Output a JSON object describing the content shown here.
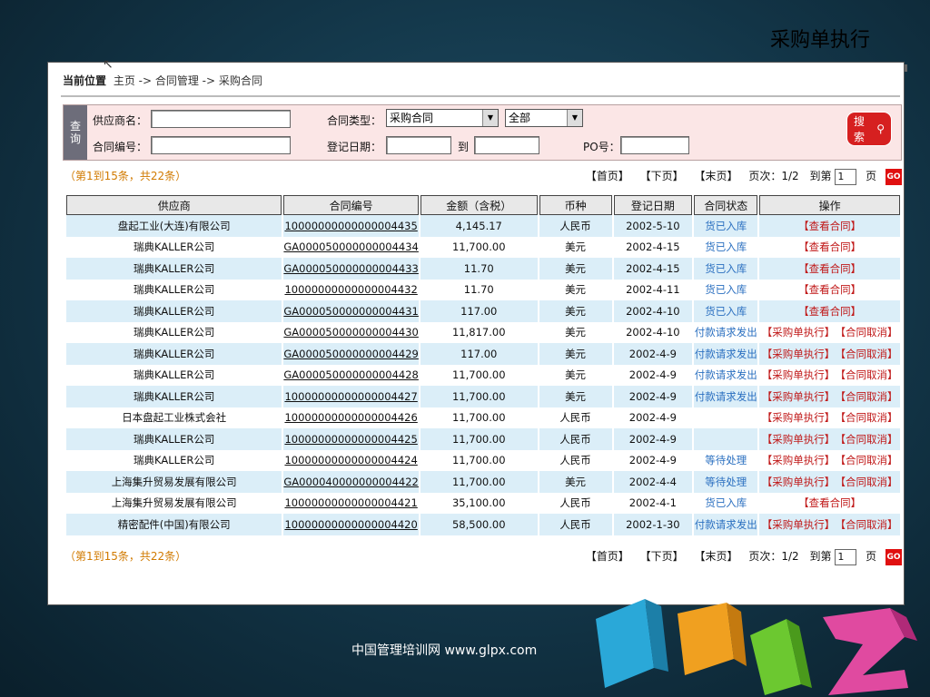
{
  "slide_title": "采购单执行",
  "footer": "中国管理培训网   www.glpx.com",
  "breadcrumb": {
    "lead": "当前位置",
    "path": "主页 -> 合同管理 -> 采购合同"
  },
  "search": {
    "tag": "查询",
    "supplier_label": "供应商名：",
    "contract_no_label": "合同编号：",
    "contract_type_label": "合同类型：",
    "contract_type_value": "采购合同",
    "scope_value": "全部",
    "reg_date_label": "登记日期：",
    "to_label": "到",
    "po_label": "PO号：",
    "button": "搜索"
  },
  "pager": {
    "count": "（第1到15条，共22条）",
    "first": "【首页】",
    "next": "【下页】",
    "last": "【末页】",
    "page_info": "页次：1/2",
    "goto_label": "到第",
    "page_value": "1",
    "page_unit": "页",
    "go": "GO"
  },
  "table": {
    "headers": [
      "供应商",
      "合同编号",
      "金额（含税）",
      "币种",
      "登记日期",
      "合同状态",
      "操作"
    ],
    "rows": [
      {
        "supplier": "盘起工业(大连)有限公司",
        "no": "10000000000000004435",
        "amount": "4,145.17",
        "currency": "人民币",
        "date": "2002-5-10",
        "status": "货已入库",
        "op1": "【查看合同】",
        "op2": ""
      },
      {
        "supplier": "瑞典KALLER公司",
        "no": "GA000050000000004434",
        "amount": "11,700.00",
        "currency": "美元",
        "date": "2002-4-15",
        "status": "货已入库",
        "op1": "【查看合同】",
        "op2": ""
      },
      {
        "supplier": "瑞典KALLER公司",
        "no": "GA000050000000004433",
        "amount": "11.70",
        "currency": "美元",
        "date": "2002-4-15",
        "status": "货已入库",
        "op1": "【查看合同】",
        "op2": ""
      },
      {
        "supplier": "瑞典KALLER公司",
        "no": "10000000000000004432",
        "amount": "11.70",
        "currency": "美元",
        "date": "2002-4-11",
        "status": "货已入库",
        "op1": "【查看合同】",
        "op2": ""
      },
      {
        "supplier": "瑞典KALLER公司",
        "no": "GA000050000000004431",
        "amount": "117.00",
        "currency": "美元",
        "date": "2002-4-10",
        "status": "货已入库",
        "op1": "【查看合同】",
        "op2": ""
      },
      {
        "supplier": "瑞典KALLER公司",
        "no": "GA000050000000004430",
        "amount": "11,817.00",
        "currency": "美元",
        "date": "2002-4-10",
        "status": "付款请求发出",
        "op1": "【采购单执行】",
        "op2": "【合同取消】"
      },
      {
        "supplier": "瑞典KALLER公司",
        "no": "GA000050000000004429",
        "amount": "117.00",
        "currency": "美元",
        "date": "2002-4-9",
        "status": "付款请求发出",
        "op1": "【采购单执行】",
        "op2": "【合同取消】"
      },
      {
        "supplier": "瑞典KALLER公司",
        "no": "GA000050000000004428",
        "amount": "11,700.00",
        "currency": "美元",
        "date": "2002-4-9",
        "status": "付款请求发出",
        "op1": "【采购单执行】",
        "op2": "【合同取消】"
      },
      {
        "supplier": "瑞典KALLER公司",
        "no": "10000000000000004427",
        "amount": "11,700.00",
        "currency": "美元",
        "date": "2002-4-9",
        "status": "付款请求发出",
        "op1": "【采购单执行】",
        "op2": "【合同取消】"
      },
      {
        "supplier": "日本盘起工业株式会社",
        "no": "10000000000000004426",
        "amount": "11,700.00",
        "currency": "人民币",
        "date": "2002-4-9",
        "status": "",
        "op1": "【采购单执行】",
        "op2": "【合同取消】"
      },
      {
        "supplier": "瑞典KALLER公司",
        "no": "10000000000000004425",
        "amount": "11,700.00",
        "currency": "人民币",
        "date": "2002-4-9",
        "status": "",
        "op1": "【采购单执行】",
        "op2": "【合同取消】"
      },
      {
        "supplier": "瑞典KALLER公司",
        "no": "10000000000000004424",
        "amount": "11,700.00",
        "currency": "人民币",
        "date": "2002-4-9",
        "status": "等待处理",
        "op1": "【采购单执行】",
        "op2": "【合同取消】"
      },
      {
        "supplier": "上海集升贸易发展有限公司",
        "no": "GA000040000000004422",
        "amount": "11,700.00",
        "currency": "美元",
        "date": "2002-4-4",
        "status": "等待处理",
        "op1": "【采购单执行】",
        "op2": "【合同取消】"
      },
      {
        "supplier": "上海集升贸易发展有限公司",
        "no": "10000000000000004421",
        "amount": "35,100.00",
        "currency": "人民币",
        "date": "2002-4-1",
        "status": "货已入库",
        "op1": "【查看合同】",
        "op2": ""
      },
      {
        "supplier": "精密配件(中国)有限公司",
        "no": "10000000000000004420",
        "amount": "58,500.00",
        "currency": "人民币",
        "date": "2002-1-30",
        "status": "付款请求发出",
        "op1": "【采购单执行】",
        "op2": "【合同取消】"
      }
    ]
  }
}
